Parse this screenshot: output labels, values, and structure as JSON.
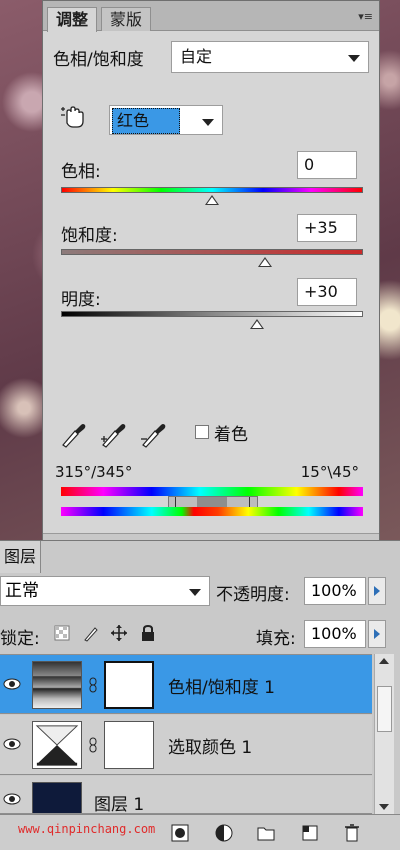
{
  "adjust_panel": {
    "tabs": [
      "调整",
      "蒙版"
    ],
    "preset_label": "色相/饱和度",
    "preset_value": "自定",
    "channel_value": "红色",
    "hue_label": "色相:",
    "hue_value": "0",
    "hue_level": 0.5,
    "saturation_label": "饱和度:",
    "saturation_value": "+35",
    "saturation_level": 0.675,
    "lightness_label": "明度:",
    "lightness_value": "+30",
    "lightness_level": 0.65,
    "colorize_label": "着色",
    "range_left": "315°/345°",
    "range_right": "15°\\45°"
  },
  "layers_panel": {
    "tab_label": "图层",
    "blend_mode": "正常",
    "opacity_label": "不透明度:",
    "opacity_value": "100%",
    "lock_label": "锁定:",
    "fill_label": "填充:",
    "fill_value": "100%",
    "layers": [
      {
        "name": "色相/饱和度 1",
        "selected": true
      },
      {
        "name": "选取颜色 1",
        "selected": false
      },
      {
        "name": "图层 1",
        "selected": false
      }
    ]
  },
  "watermark": "www.qinpinchang.com"
}
